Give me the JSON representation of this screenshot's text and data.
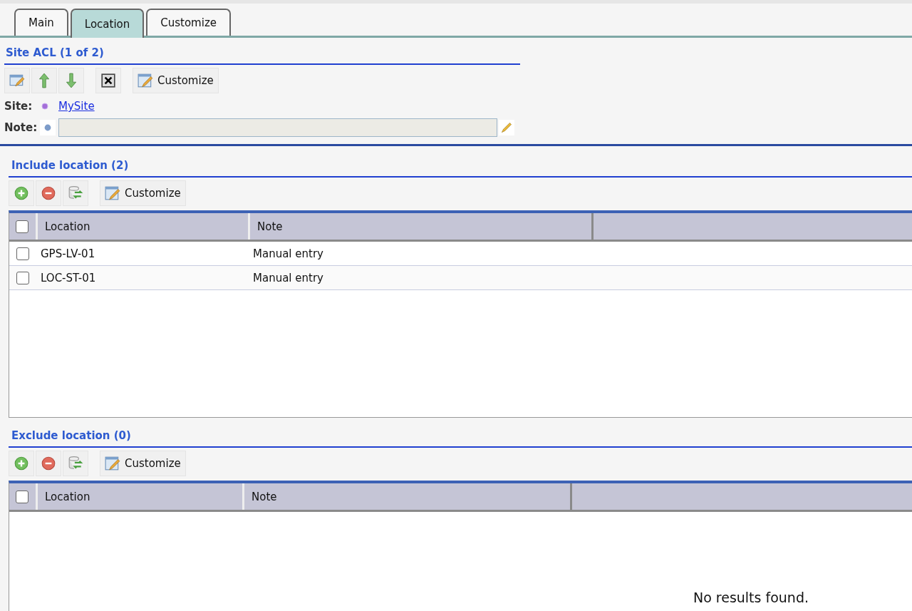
{
  "tabs": [
    {
      "label": "Main",
      "selected": false
    },
    {
      "label": "Location",
      "selected": true
    },
    {
      "label": "Customize",
      "selected": false
    }
  ],
  "site_acl": {
    "title": "Site ACL (1 of 2)",
    "customize_label": "Customize",
    "site_label": "Site:",
    "site_value": "MySite",
    "note_label": "Note:"
  },
  "include": {
    "title": "Include location (2)",
    "customize_label": "Customize",
    "columns": [
      "Location",
      "Note"
    ],
    "header_checked": false,
    "rows": [
      {
        "location": "GPS-LV-01",
        "note": "Manual entry",
        "checked": false
      },
      {
        "location": "LOC-ST-01",
        "note": "Manual entry",
        "checked": false
      }
    ]
  },
  "exclude": {
    "title": "Exclude location (0)",
    "customize_label": "Customize",
    "columns": [
      "Location",
      "Note"
    ],
    "header_checked": false,
    "empty_message": "No results found."
  }
}
